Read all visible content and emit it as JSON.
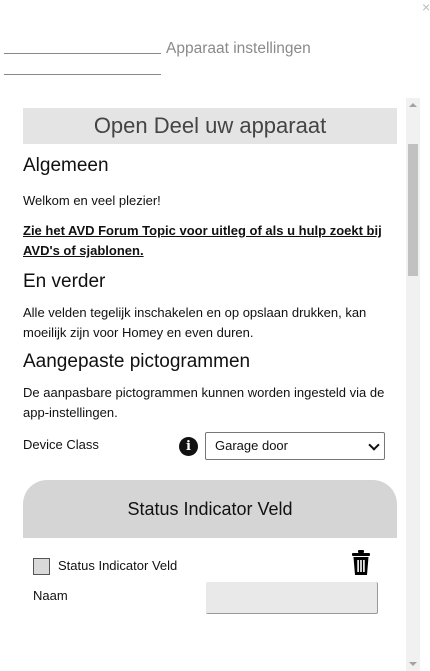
{
  "window": {
    "close_glyph": "×"
  },
  "header": {
    "title": "Apparaat instellingen"
  },
  "banner": {
    "title": "Open Deel uw apparaat"
  },
  "sections": {
    "general": {
      "heading": "Algemeen",
      "welcome": "Welkom en veel plezier!",
      "forum_link": "Zie het AVD Forum Topic voor uitleg of als u hulp zoekt bij AVD's of sjablonen."
    },
    "further": {
      "heading": "En verder",
      "text": "Alle velden tegelijk inschakelen en op opslaan drukken, kan moeilijk zijn voor Homey en even duren."
    },
    "icons": {
      "heading": "Aangepaste pictogrammen",
      "text": "De aanpasbare pictogrammen kunnen worden ingesteld via de app-instellingen."
    }
  },
  "device_class": {
    "label": "Device Class",
    "info_glyph": "i",
    "selected": "Garage door"
  },
  "status_card": {
    "title": "Status Indicator Veld",
    "checkbox_label": "Status Indicator Veld",
    "checked": false,
    "name_label": "Naam",
    "name_value": ""
  },
  "icons": {
    "close": "close-icon",
    "info": "info-icon",
    "trash": "trash-icon",
    "dropdown": "chevron-down-icon"
  }
}
